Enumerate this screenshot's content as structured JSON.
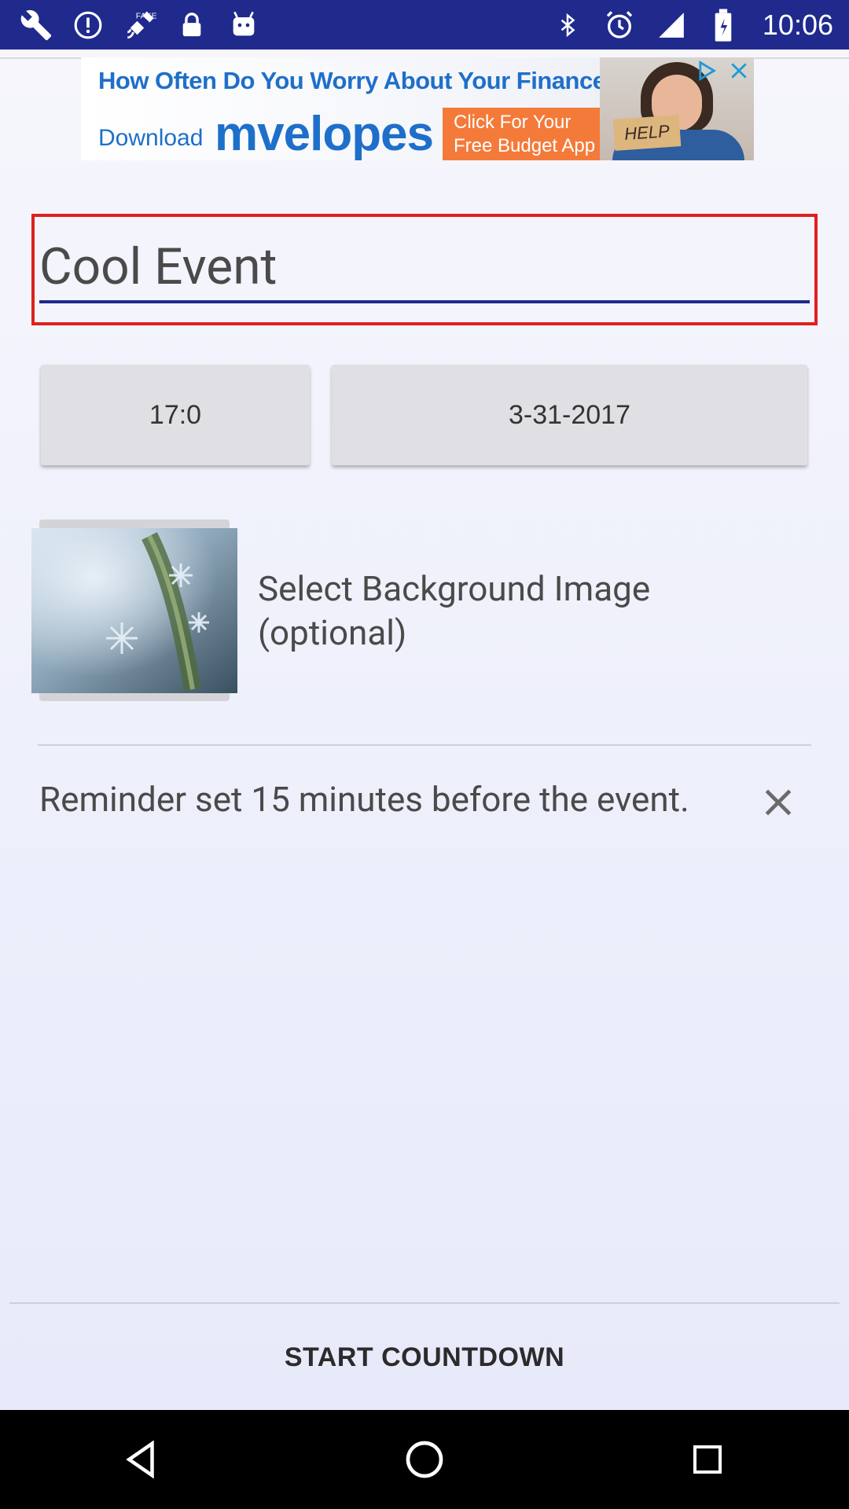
{
  "status_bar": {
    "time": "10:06",
    "left_icons": [
      "wrench-icon",
      "info-icon",
      "fake-gps-icon",
      "lock-icon",
      "android-icon"
    ],
    "right_icons": [
      "bluetooth-icon",
      "alarm-icon",
      "signal-icon",
      "battery-icon"
    ]
  },
  "ad": {
    "headline": "How Often Do You Worry About Your Finances?",
    "download_label": "Download",
    "brand": "mvelopes",
    "cta_line1": "Click For Your",
    "cta_line2": "Free Budget App",
    "sign_text": "HELP"
  },
  "event": {
    "title_value": "Cool Event",
    "time_label": "17:0",
    "date_label": "3-31-2017",
    "background_label_line1": "Select Background Image",
    "background_label_line2": "(optional)",
    "reminder_text": "Reminder set 15 minutes before the event."
  },
  "actions": {
    "start_label": "START COUNTDOWN"
  },
  "colors": {
    "status_bar": "#1f2a8c",
    "highlight_border": "#e01f1f",
    "input_underline": "#1f2a8c",
    "ad_blue": "#1e6fc9",
    "ad_orange": "#f47a3a"
  },
  "nav_bar": {
    "icons": [
      "back-icon",
      "home-icon",
      "recents-icon"
    ]
  }
}
